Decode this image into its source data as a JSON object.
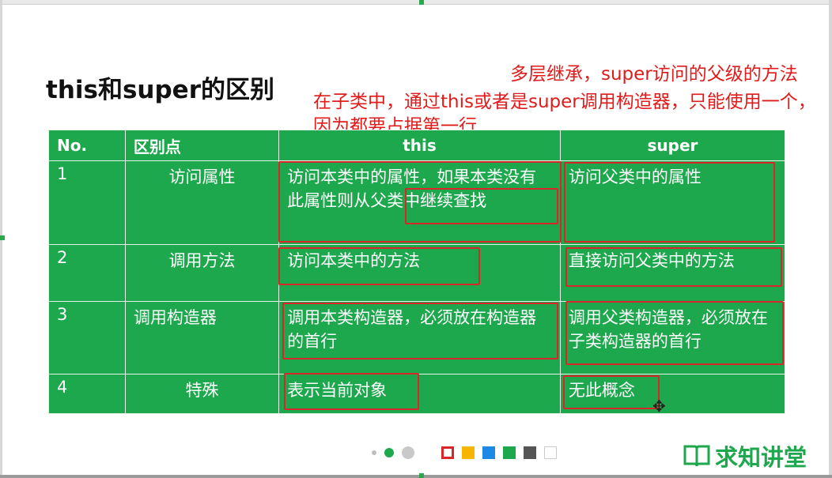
{
  "slide": {
    "title": "this和super的区别",
    "note_top": "多层继承，super访问的父级的方法",
    "note_middle": "在子类中，通过this或者是super调用构造器，只能使用一个，因为都要占据第一行"
  },
  "table": {
    "headers": [
      "No.",
      "区别点",
      "this",
      "super"
    ],
    "rows": [
      {
        "no": "1",
        "point": "访问属性",
        "this_a": "访问本类中的属性，如果本类没有此属性则",
        "this_b": "从父类中继续查找",
        "super": "访问父类中的属性"
      },
      {
        "no": "2",
        "point": "调用方法",
        "this": "访问本类中的方法",
        "super": "直接访问父类中的方法"
      },
      {
        "no": "3",
        "point": "调用构造器",
        "this": "调用本类构造器，必须放在构造器的首行",
        "super": "调用父类构造器，必须放在子类构造器的首行"
      },
      {
        "no": "4",
        "point": "特殊",
        "this": "表示当前对象",
        "super": "无此概念"
      }
    ]
  },
  "toolbar": {
    "swatches": [
      "#ffffff",
      "#f7b500",
      "#1e88e5",
      "#1ea84d",
      "#555555",
      "#ffffff"
    ],
    "accent": "#d8262a"
  },
  "brand": {
    "text": "求知讲堂",
    "color": "#1ea84d"
  }
}
